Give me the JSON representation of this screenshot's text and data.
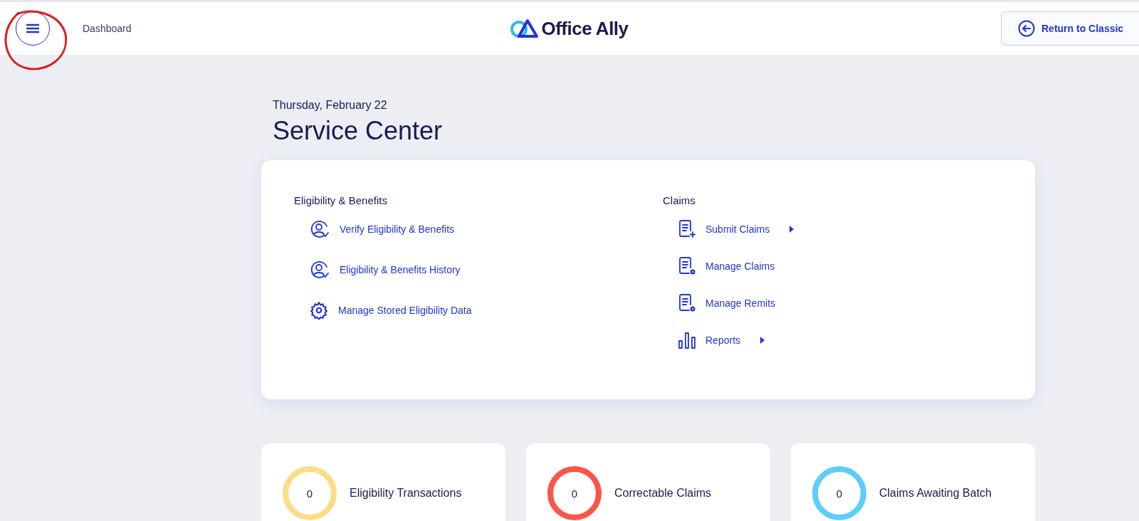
{
  "header": {
    "breadcrumb": "Dashboard",
    "logo_text": "Office Ally",
    "return_button": "Return to Classic"
  },
  "date": "Thursday, February 22",
  "title": "Service Center",
  "sections": [
    {
      "heading": "Eligibility & Benefits",
      "items": [
        {
          "label": "Verify Eligibility & Benefits",
          "kind": "person-check",
          "has_submenu": false
        },
        {
          "label": "Eligibility & Benefits History",
          "kind": "person-check",
          "has_submenu": false
        },
        {
          "label": "Manage Stored Eligibility Data",
          "kind": "gear",
          "has_submenu": false
        }
      ]
    },
    {
      "heading": "Claims",
      "items": [
        {
          "label": "Submit Claims",
          "kind": "doc-plus",
          "has_submenu": true
        },
        {
          "label": "Manage Claims",
          "kind": "doc-gear",
          "has_submenu": false
        },
        {
          "label": "Manage Remits",
          "kind": "doc-gear",
          "has_submenu": false
        },
        {
          "label": "Reports",
          "kind": "bars",
          "has_submenu": true
        }
      ]
    }
  ],
  "stats": [
    {
      "count": "0",
      "label": "Eligibility Transactions",
      "color": "#fddc85"
    },
    {
      "count": "0",
      "label": "Correctable Claims",
      "color": "#fb5548"
    },
    {
      "count": "0",
      "label": "Claims Awaiting Batch",
      "color": "#5dcdfb"
    }
  ]
}
